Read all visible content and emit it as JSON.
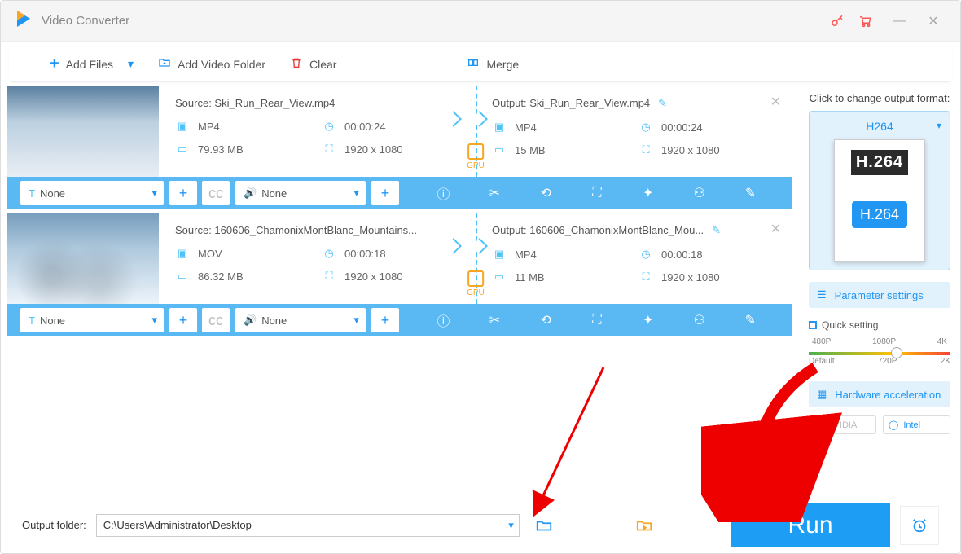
{
  "app": {
    "title": "Video Converter"
  },
  "toolbar": {
    "add_files": "Add Files",
    "add_folder": "Add Video Folder",
    "clear": "Clear",
    "merge": "Merge"
  },
  "files": [
    {
      "source_label": "Source: Ski_Run_Rear_View.mp4",
      "output_label": "Output: Ski_Run_Rear_View.mp4",
      "src": {
        "format": "MP4",
        "duration": "00:00:24",
        "size": "79.93 MB",
        "res": "1920 x 1080"
      },
      "out": {
        "format": "MP4",
        "duration": "00:00:24",
        "size": "15 MB",
        "res": "1920 x 1080"
      },
      "gpu": "GPU",
      "subtitle_sel": "None",
      "audio_sel": "None"
    },
    {
      "source_label": "Source: 160606_ChamonixMontBlanc_Mountains...",
      "output_label": "Output: 160606_ChamonixMontBlanc_Mou...",
      "src": {
        "format": "MOV",
        "duration": "00:00:18",
        "size": "86.32 MB",
        "res": "1920 x 1080"
      },
      "out": {
        "format": "MP4",
        "duration": "00:00:18",
        "size": "11 MB",
        "res": "1920 x 1080"
      },
      "gpu": "GPU",
      "subtitle_sel": "None",
      "audio_sel": "None"
    }
  ],
  "side": {
    "title": "Click to change output format:",
    "format_name": "H264",
    "card_top": "H.264",
    "card_bottom": "H.264",
    "param_btn": "Parameter settings",
    "quick_label": "Quick setting",
    "ticks_top": [
      "480P",
      "1080P",
      "4K"
    ],
    "ticks_bottom": [
      "Default",
      "720P",
      "2K"
    ],
    "hw_btn": "Hardware acceleration",
    "vendor_nvidia": "NVIDIA",
    "vendor_intel": "Intel"
  },
  "bottom": {
    "label": "Output folder:",
    "path": "C:\\Users\\Administrator\\Desktop",
    "run": "Run"
  }
}
